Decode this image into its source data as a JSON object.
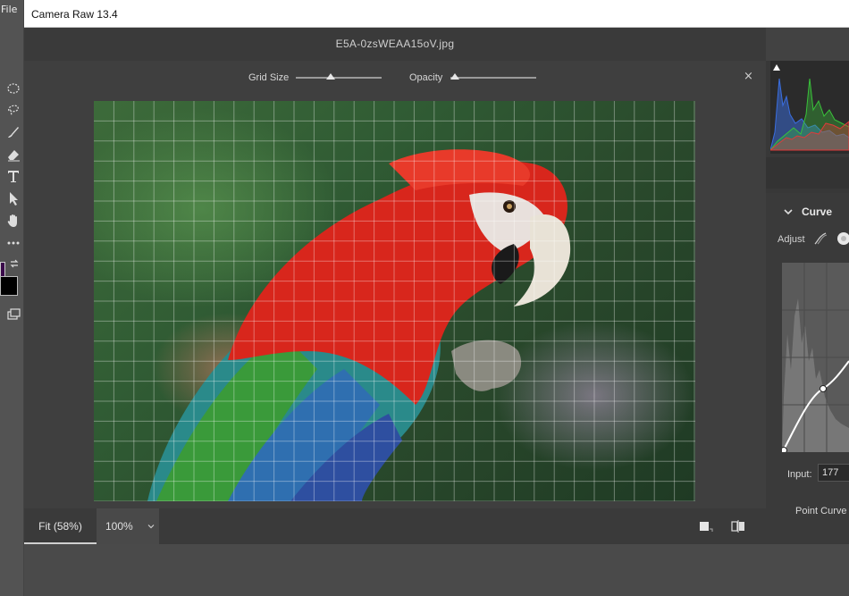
{
  "host": {
    "menu_file": "File"
  },
  "window": {
    "title": "Camera Raw 13.4"
  },
  "document": {
    "file_name": "E5A-0zsWEAA15oV.jpg"
  },
  "overlay": {
    "grid_size_label": "Grid Size",
    "grid_size_value": 0.4,
    "opacity_label": "Opacity",
    "opacity_value": 0.0,
    "close_symbol": "×"
  },
  "zoom": {
    "fit_label": "Fit (58%)",
    "hundred_label": "100%"
  },
  "curve_panel": {
    "section_title": "Curve",
    "adjust_label": "Adjust",
    "input_label": "Input:",
    "input_value": "177",
    "point_curve_label": "Point Curve"
  },
  "icons": {
    "toolbar": [
      "ellipse-marquee-icon",
      "lasso-icon",
      "brush-icon",
      "eraser-icon",
      "type-icon",
      "pointer-icon",
      "hand-icon",
      "more-icon",
      "swap-icon",
      "screen-mode-icon"
    ]
  },
  "colors": {
    "accent": "#d0d0d0",
    "histogram_red": "#e03a3a",
    "histogram_green": "#39c23a",
    "histogram_blue": "#3a6ee0"
  }
}
